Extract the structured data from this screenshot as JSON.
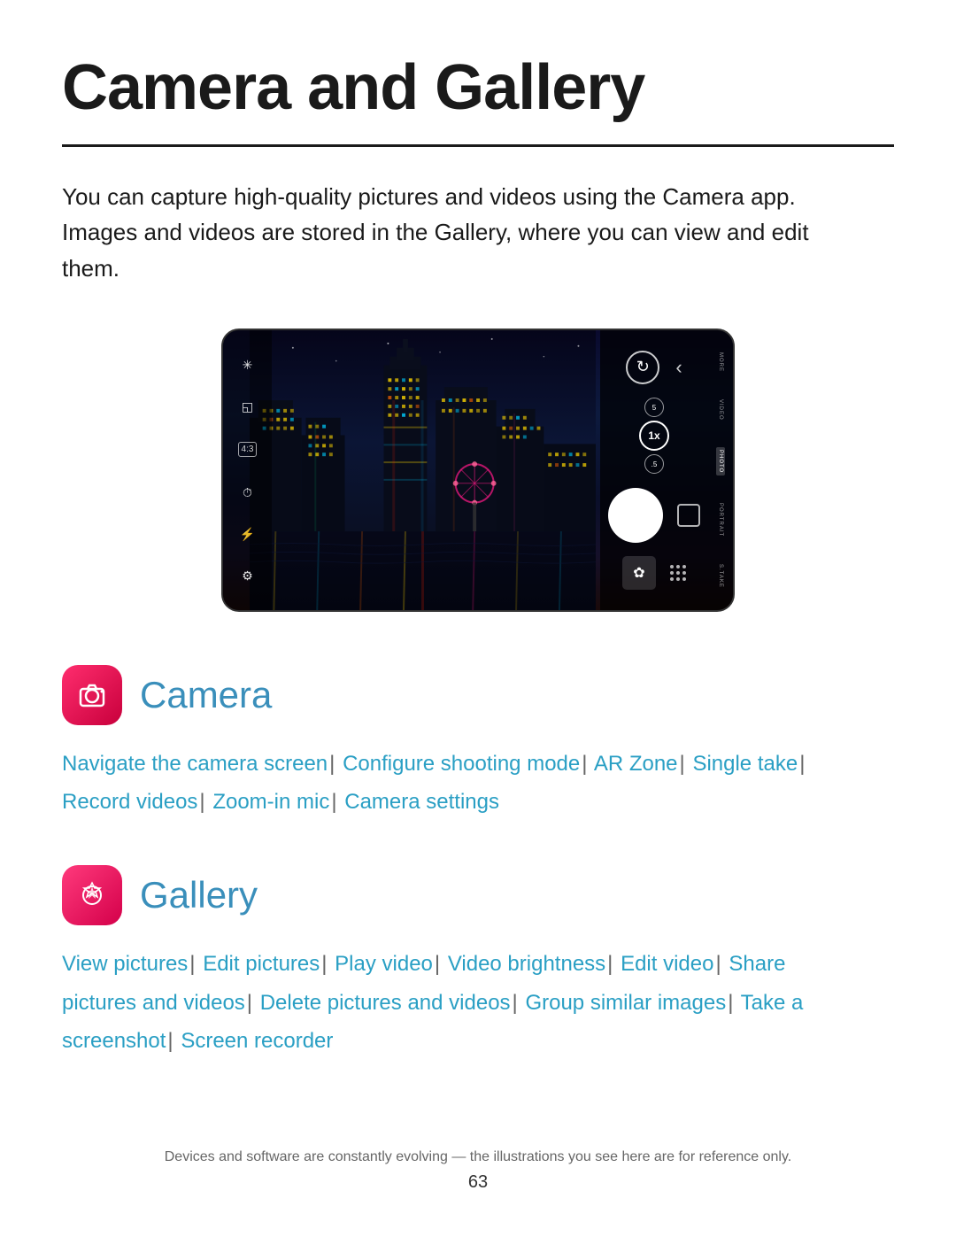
{
  "page": {
    "title": "Camera and Gallery",
    "intro": "You can capture high-quality pictures and videos using the Camera app. Images and videos are stored in the Gallery, where you can view and edit them."
  },
  "camera_section": {
    "app_name": "Camera",
    "links": [
      "Navigate the camera screen",
      "Configure shooting mode",
      "AR Zone",
      "Single take",
      "Record videos",
      "Zoom-in mic",
      "Camera settings"
    ]
  },
  "gallery_section": {
    "app_name": "Gallery",
    "links": [
      "View pictures",
      "Edit pictures",
      "Play video",
      "Video brightness",
      "Edit video",
      "Share pictures and videos",
      "Delete pictures and videos",
      "Group similar images",
      "Take a screenshot",
      "Screen recorder"
    ]
  },
  "camera_modes": [
    "MORE",
    "VIDEO",
    "PHOTO",
    "PORTRAIT",
    "TAKE"
  ],
  "zoom_levels": [
    "5",
    "1x",
    ".5"
  ],
  "footer": {
    "note": "Devices and software are constantly evolving — the illustrations you see here are for reference only.",
    "page_number": "63"
  }
}
